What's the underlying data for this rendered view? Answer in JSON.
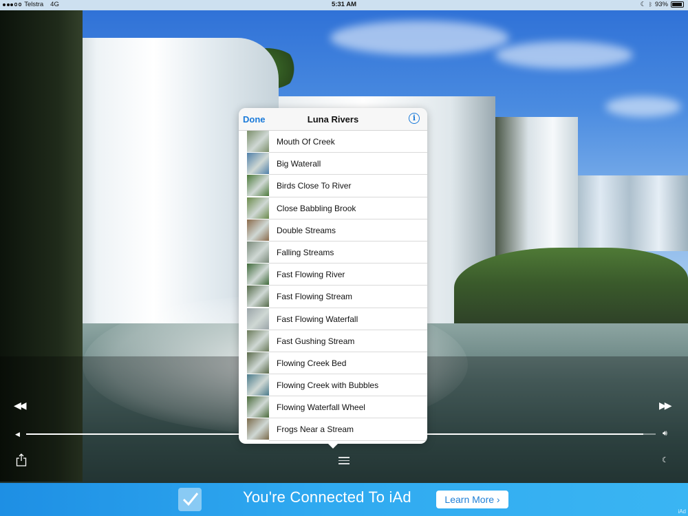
{
  "status_bar": {
    "carrier": "Telstra",
    "network": "4G",
    "time": "5:31 AM",
    "battery": "93%",
    "battery_level": 0.93
  },
  "popover": {
    "title": "Luna Rivers",
    "done_label": "Done",
    "info_icon": "info-icon",
    "tracks": [
      {
        "label": "Mouth Of Creek",
        "thumb_color": "#7b8f6a"
      },
      {
        "label": "Big Waterall",
        "thumb_color": "#4f7fa8"
      },
      {
        "label": "Birds Close To River",
        "thumb_color": "#4c7a3a"
      },
      {
        "label": "Close Babbling Brook",
        "thumb_color": "#6a8a4a"
      },
      {
        "label": "Double Streams",
        "thumb_color": "#8a6a4a"
      },
      {
        "label": "Falling Streams",
        "thumb_color": "#7a8a7a"
      },
      {
        "label": "Fast Flowing River",
        "thumb_color": "#3f6a3a"
      },
      {
        "label": "Fast Flowing Stream",
        "thumb_color": "#556b4a"
      },
      {
        "label": "Fast Flowing Waterfall",
        "thumb_color": "#9aa4a8"
      },
      {
        "label": "Fast Gushing Stream",
        "thumb_color": "#6a7a5a"
      },
      {
        "label": "Flowing Creek Bed",
        "thumb_color": "#5a6a4a"
      },
      {
        "label": "Flowing Creek with Bubbles",
        "thumb_color": "#4a7a8a"
      },
      {
        "label": "Flowing Waterfall Wheel",
        "thumb_color": "#4a6a3a"
      },
      {
        "label": "Frogs Near a Stream",
        "thumb_color": "#7a6a4a"
      }
    ]
  },
  "player": {
    "volume_level": 0.98,
    "icons": [
      "previous-icon",
      "next-icon",
      "volume-low-icon",
      "volume-high-icon",
      "share-icon",
      "list-icon",
      "moon-icon"
    ]
  },
  "ad_banner": {
    "text": "You're Connected To iAd",
    "button_label": "Learn More",
    "tag": "iAd"
  },
  "colors": {
    "accent": "#1a7ad9",
    "ad_blue": "#2fa9f0"
  }
}
